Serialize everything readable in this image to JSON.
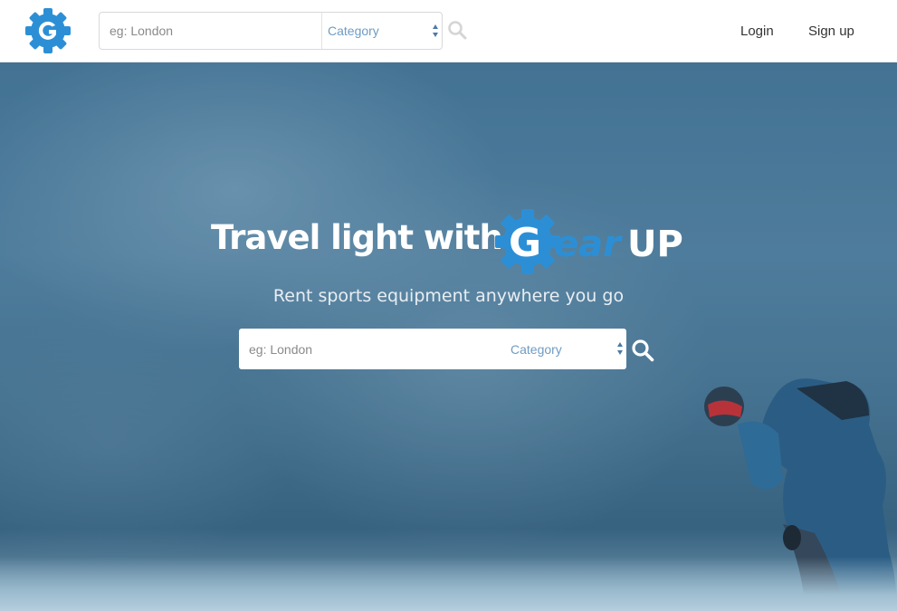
{
  "nav": {
    "logo_icon": "gear-g-logo-icon",
    "search": {
      "placeholder": "eg: London",
      "category": "Category"
    },
    "search_icon": "search-icon",
    "login": "Login",
    "signup": "Sign up"
  },
  "hero": {
    "title": "Travel light with",
    "brand_g": "G",
    "brand_ear": "ear",
    "brand_up": "UP",
    "subtitle": "Rent sports equipment anywhere you go",
    "search": {
      "placeholder": "eg: London",
      "category": "Category"
    },
    "search_icon": "search-icon"
  },
  "colors": {
    "brand_blue": "#2c8fd6",
    "link_text": "#333333",
    "category_text": "#6f9cc4"
  }
}
